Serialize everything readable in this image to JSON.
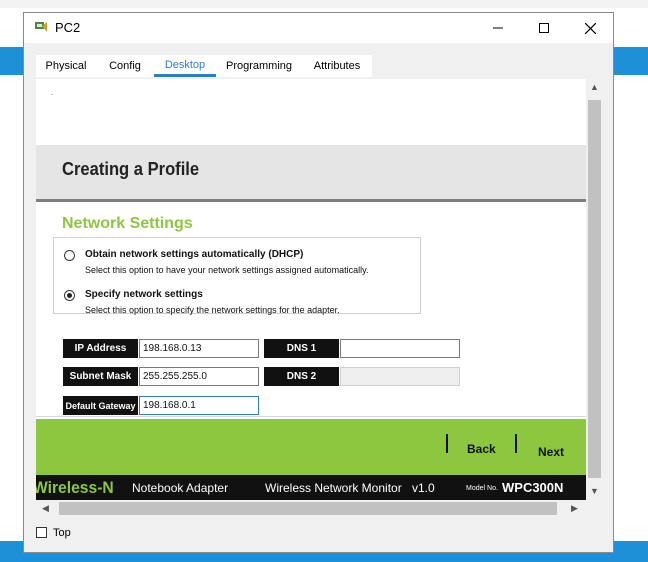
{
  "window": {
    "title": "PC2",
    "minimize_glyph": "—",
    "maximize_glyph": "☐",
    "close_glyph": "✕"
  },
  "tabs": [
    {
      "label": "Physical"
    },
    {
      "label": "Config"
    },
    {
      "label": "Desktop",
      "active": true
    },
    {
      "label": "Programming"
    },
    {
      "label": "Attributes"
    }
  ],
  "page": {
    "dot": ".",
    "header_title": "Creating a Profile",
    "section_title": "Network Settings",
    "options": [
      {
        "title": "Obtain network settings automatically (DHCP)",
        "desc": "Select this option to have your network settings assigned automatically.",
        "selected": false
      },
      {
        "title": "Specify network settings",
        "desc": "Select this option to specify the network settings for the adapter.",
        "selected": true
      }
    ],
    "fields": {
      "ip_label": "IP Address",
      "ip_value": "198.168.0.13",
      "mask_label": "Subnet Mask",
      "mask_value": "255.255.255.0",
      "gateway_label": "Default Gateway",
      "gateway_value": "198.168.0.1",
      "dns1_label": "DNS 1",
      "dns1_value": "",
      "dns2_label": "DNS 2",
      "dns2_value": ""
    },
    "nav": {
      "back": "Back",
      "next": "Next"
    },
    "brand": {
      "product": "Wireless-N",
      "adapter": "Notebook Adapter",
      "monitor": "Wireless Network Monitor",
      "version": "v1.0",
      "model_prefix": "Model No.",
      "model": "WPC300N"
    }
  },
  "footer": {
    "top_label": "Top",
    "top_checked": false
  },
  "colors": {
    "accent": "#8dc63f",
    "tab_active": "#2b7fc8",
    "brand_bar": "#111111",
    "header_band": "#e5e5e5"
  }
}
